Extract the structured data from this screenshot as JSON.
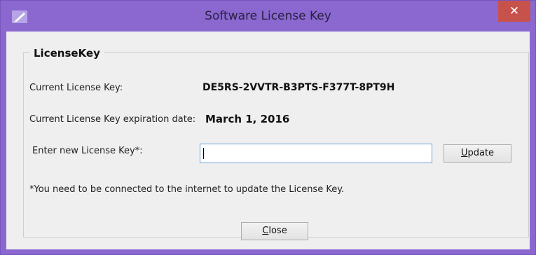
{
  "window": {
    "title": "Software License Key",
    "close_glyph": "✕",
    "app_icon": "feather-pen-icon",
    "accent_color": "#8a68cf",
    "close_color": "#c7514b"
  },
  "group": {
    "title": "LicenseKey"
  },
  "current_key": {
    "label": "Current License Key:",
    "value": "DE5RS-2VVTR-B3PTS-F377T-8PT9H"
  },
  "expiration": {
    "label": "Current License Key expiration date:",
    "value": "March 1, 2016"
  },
  "new_key": {
    "label": "Enter new License Key*:",
    "value": "",
    "placeholder": ""
  },
  "update_button": {
    "mnemonic": "U",
    "rest": "pdate"
  },
  "note": "*You need to be connected to the internet to update the License Key.",
  "close_button": {
    "mnemonic": "C",
    "rest": "lose"
  }
}
